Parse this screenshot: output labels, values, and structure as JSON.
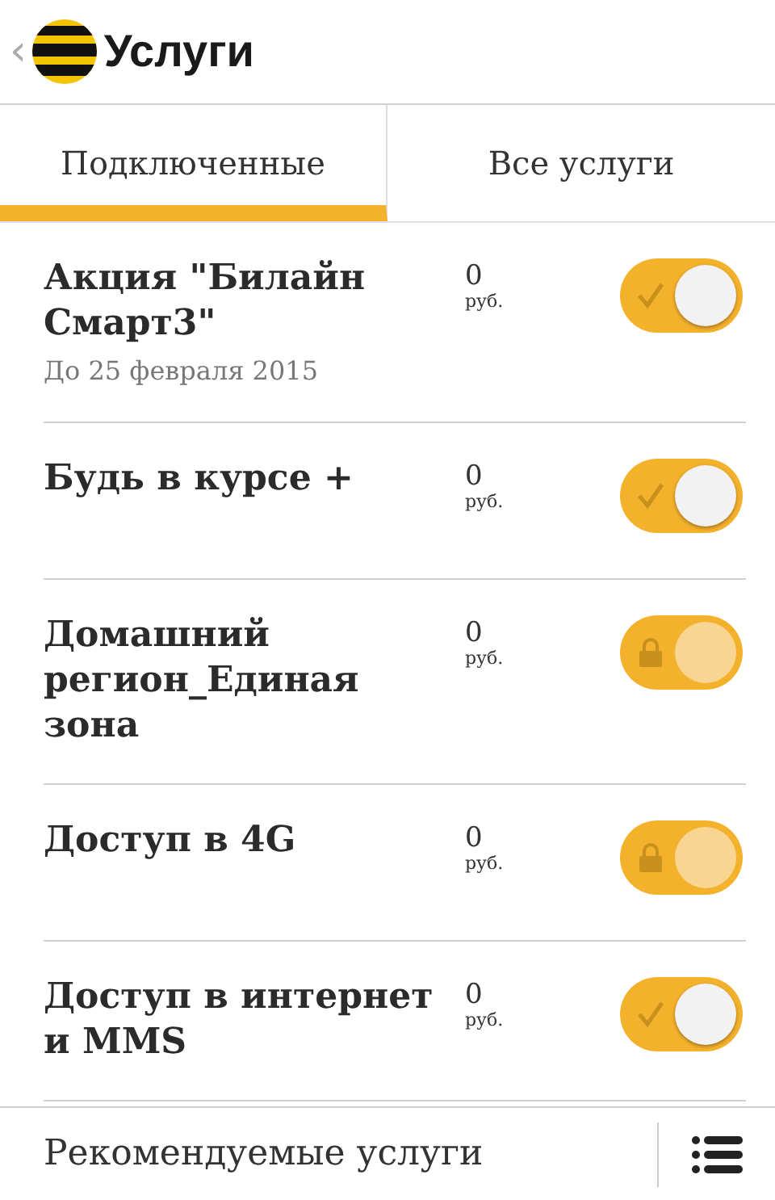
{
  "header": {
    "back": "‹",
    "title": "Услуги"
  },
  "tabs": [
    {
      "label": "Подключенные",
      "selected": true
    },
    {
      "label": "Все услуги",
      "selected": false
    }
  ],
  "services": [
    {
      "name": "Акция \"Билайн Смарт3\"",
      "note": "До 25 февраля 2015",
      "price": "0",
      "unit": "руб.",
      "on": true,
      "locked": false
    },
    {
      "name": "Будь в курсе +",
      "price": "0",
      "unit": "руб.",
      "on": true,
      "locked": false
    },
    {
      "name": "Домашний регион_Единая зона",
      "price": "0",
      "unit": "руб.",
      "on": true,
      "locked": true
    },
    {
      "name": "Доступ в 4G",
      "price": "0",
      "unit": "руб.",
      "on": true,
      "locked": true
    },
    {
      "name": "Доступ в интернет и MMS",
      "price": "0",
      "unit": "руб.",
      "on": true,
      "locked": false
    }
  ],
  "footer": {
    "label": "Рекомендуемые услуги"
  }
}
